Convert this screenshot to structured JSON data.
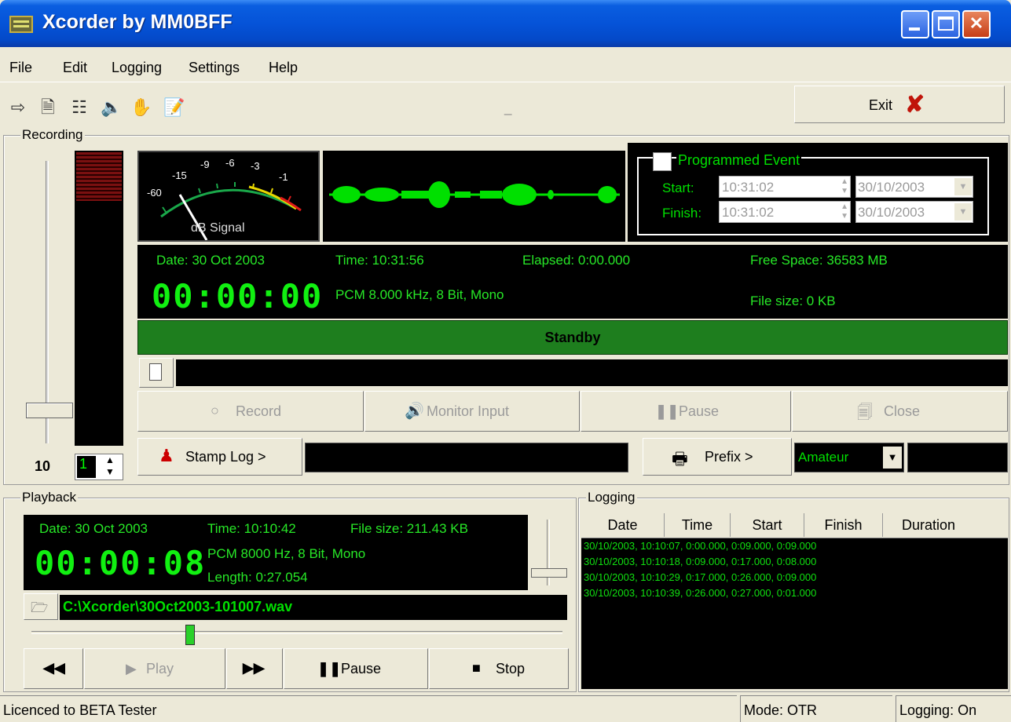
{
  "window": {
    "title": "Xcorder by MM0BFF"
  },
  "menu": {
    "file": "File",
    "edit": "Edit",
    "logging": "Logging",
    "settings": "Settings",
    "help": "Help"
  },
  "toolbar": {
    "exit_label": "Exit",
    "separator": "_"
  },
  "recording": {
    "group_label": "Recording",
    "level_value": "10",
    "spin_value": "1",
    "vu_labels": [
      "-60",
      "-15",
      "-9",
      "-6",
      "-3",
      "-1"
    ],
    "vu_caption": "dB Signal",
    "programmed_event": {
      "label": "Programmed Event",
      "start_label": "Start:",
      "finish_label": "Finish:",
      "start_time": "10:31:02",
      "finish_time": "10:31:02",
      "start_date": "30/10/2003",
      "finish_date": "30/10/2003"
    },
    "info": {
      "date": "Date:  30 Oct 2003",
      "time": "Time:  10:31:56",
      "elapsed": "Elapsed:  0:00.000",
      "free_space": "Free Space: 36583 MB",
      "counter": "00:00:00",
      "format": "PCM 8.000 kHz, 8 Bit, Mono",
      "file_size": "File size:  0 KB"
    },
    "status": "Standby",
    "buttons": {
      "record": "Record",
      "monitor": "Monitor Input",
      "pause": "Pause",
      "close": "Close",
      "stamp_log": "Stamp Log >",
      "prefix": "Prefix >"
    },
    "prefix_select": "Amateur"
  },
  "playback": {
    "group_label": "Playback",
    "date": "Date:  30 Oct 2003",
    "time": "Time:  10:10:42",
    "file_size": "File size:  211.43 KB",
    "counter": "00:00:08",
    "format": "PCM 8000 Hz, 8 Bit, Mono",
    "length": "Length:  0:27.054",
    "file_path": "C:\\Xcorder\\30Oct2003-101007.wav",
    "buttons": {
      "play": "Play",
      "pause": "Pause",
      "stop": "Stop"
    }
  },
  "logging": {
    "group_label": "Logging",
    "columns": [
      "Date",
      "Time",
      "Start",
      "Finish",
      "Duration"
    ],
    "rows": [
      "30/10/2003,  10:10:07,  0:00.000,  0:09.000,    0:09.000",
      "30/10/2003,  10:10:18,  0:09.000,  0:17.000,    0:08.000",
      "30/10/2003,  10:10:29,  0:17.000,  0:26.000,    0:09.000",
      "30/10/2003,  10:10:39,  0:26.000,  0:27.000,    0:01.000"
    ]
  },
  "statusbar": {
    "licence": "Licenced to BETA Tester",
    "mode": "Mode: OTR",
    "logging": "Logging: On"
  },
  "colors": {
    "accent_green": "#00e000",
    "status_bar_green": "#1e7e1e",
    "close_red": "#c0140a"
  }
}
